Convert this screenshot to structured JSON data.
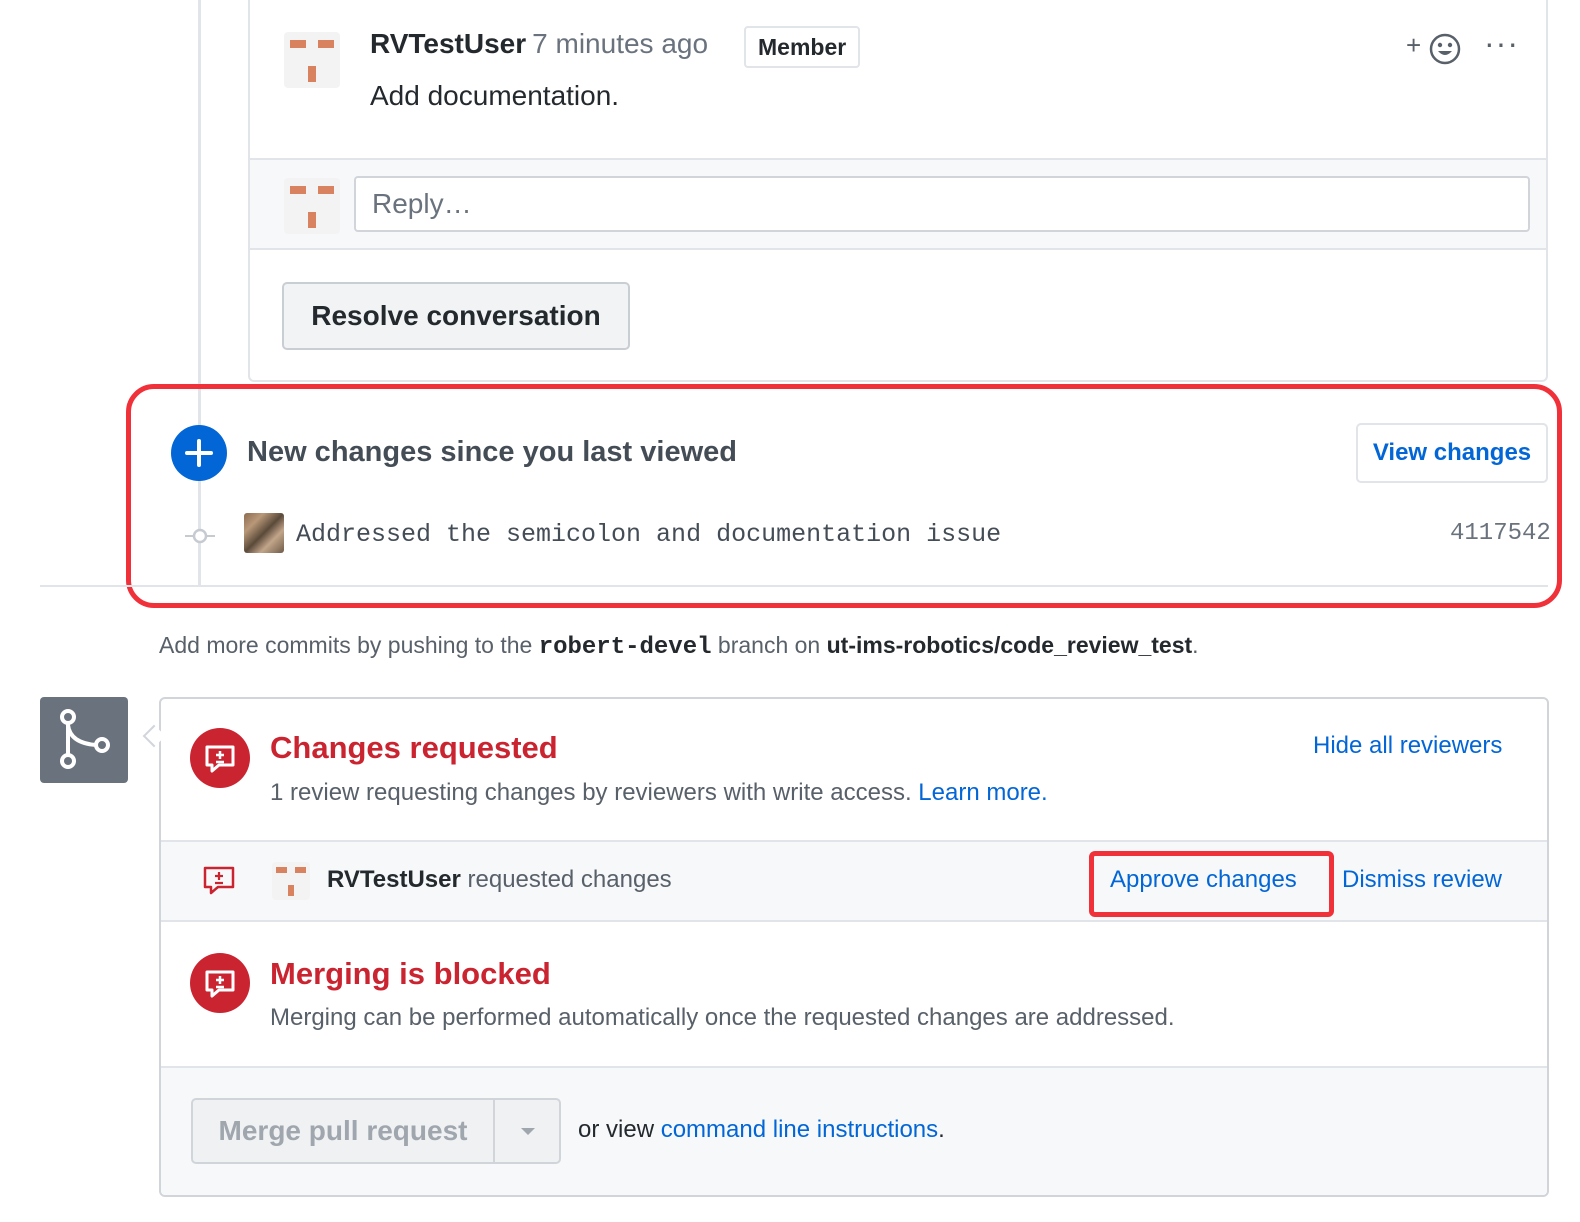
{
  "comment": {
    "author": "RVTestUser",
    "time_ago": "7 minutes ago",
    "badge": "Member",
    "body": "Add documentation.",
    "react_label": "+",
    "more_label": "···",
    "reply_placeholder": "Reply…",
    "resolve_label": "Resolve conversation"
  },
  "new_changes": {
    "title": "New changes since you last viewed",
    "view_label": "View changes",
    "commit_message": "Addressed the semicolon and documentation issue",
    "commit_sha": "4117542"
  },
  "push_hint": {
    "prefix": "Add more commits by pushing to the",
    "branch": "robert-devel",
    "middle": "branch on",
    "repo": "ut-ims-robotics/code_review_test",
    "suffix": "."
  },
  "merge": {
    "changes_title": "Changes requested",
    "changes_desc": "1 review requesting changes by reviewers with write access.",
    "learn_more": "Learn more.",
    "hide_reviewers": "Hide all reviewers",
    "reviewer_name": "RVTestUser",
    "reviewer_action": "requested changes",
    "approve_label": "Approve changes",
    "dismiss_label": "Dismiss review",
    "blocked_title": "Merging is blocked",
    "blocked_desc": "Merging can be performed automatically once the requested changes are addressed.",
    "merge_button": "Merge pull request",
    "or_view": "or view",
    "cmdline_link": "command line instructions",
    "cmdline_suffix": "."
  },
  "colors": {
    "link": "#0366d6",
    "danger": "#cb2431",
    "highlight": "#f0313a",
    "identicon": "#d9825f"
  },
  "icons": [
    "identicon-avatar",
    "smiley-icon",
    "kebab-icon",
    "plus-icon",
    "commit-dot-icon",
    "git-pull-request-icon",
    "request-changes-icon",
    "caret-down-icon"
  ]
}
